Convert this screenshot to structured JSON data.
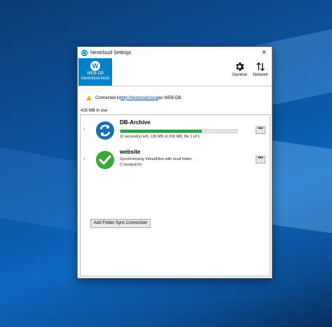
{
  "window": {
    "title": "Nextcloud Settings",
    "close_glyph": "×"
  },
  "account": {
    "avatar_letter": "W",
    "name": "WEB-DB",
    "host": "nextcloud.local"
  },
  "toolbar": {
    "general_label": "General",
    "network_label": "Network"
  },
  "status": {
    "prefix": "Connected to ",
    "url": "http://nextcloud.local",
    "suffix": " as WEB-DB."
  },
  "quota_text": "416 MB in use",
  "folders": [
    {
      "name": "DB-Archive",
      "icon": "sync-icon",
      "progress": 0.7,
      "detail": "11 second(s) left, 135 MB of 208 MB, file 1 of 1"
    },
    {
      "name": "website",
      "icon": "check-icon",
      "status": "Synchronizing VirtualFiles with local folder",
      "path": "C:\\inetpub\\hr"
    }
  ],
  "add_folder_label": "Add Folder Sync Connection",
  "colors": {
    "accent": "#0082c9",
    "progress": "#1fa73a",
    "sync_icon": "#1a6fb0",
    "check_icon": "#3aa935"
  }
}
